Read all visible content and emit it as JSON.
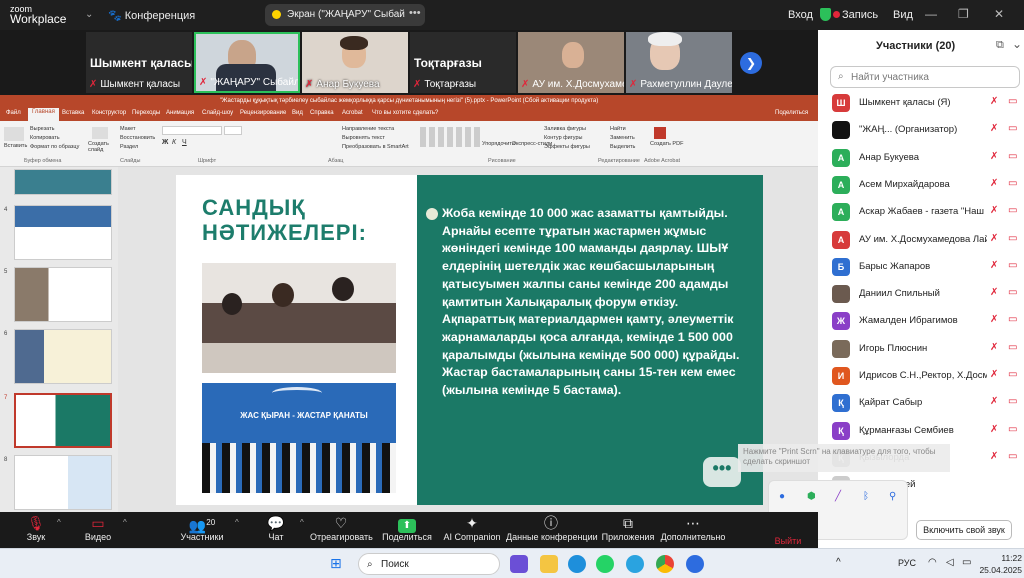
{
  "zoom": {
    "logo_line1": "zoom",
    "logo_line2": "Workplace",
    "conference": "Конференция",
    "screen_share": "Экран (\"ЖАҢАРУ\" Сыбайлас Ж",
    "login": "Вход",
    "record": "Запись",
    "view": "Вид"
  },
  "strip": {
    "tiles": [
      {
        "big": "Шымкент қаласы",
        "name": "Шымкент қаласы"
      },
      {
        "big": "",
        "name": "\"ЖАҢАРУ\" Сыбайлас Же..."
      },
      {
        "big": "",
        "name": "Анар Букуева"
      },
      {
        "big": "Тоқтарғазы",
        "name": "Тоқтарғазы"
      },
      {
        "big": "",
        "name": "АУ им. Х.Досмухамедо..."
      },
      {
        "big": "",
        "name": "Рахметуллин Даулетк..."
      }
    ]
  },
  "ppt": {
    "title": "\"Жастарды құқықтық тәрбиелеу сыбайлас жемқорлыққа қарсы дүниетанымының негізі\" (5).pptx - PowerPoint (Сбой активации продукта)",
    "menu": [
      "Файл",
      "Главная",
      "Вставка",
      "Конструктор",
      "Переходы",
      "Анимация",
      "Слайд-шоу",
      "Рецензирование",
      "Вид",
      "Справка",
      "Acrobat",
      "Что вы хотите сделать?",
      "Поделиться"
    ],
    "ribbon": {
      "clipboard": "Буфер обмена",
      "slides": "Слайды",
      "font": "Шрифт",
      "paragraph": "Абзац",
      "drawing": "Рисование",
      "editing": "Редактирование",
      "adobe": "Adobe Acrobat",
      "cut": "Вырезать",
      "copy": "Копировать",
      "format": "Формат по образцу",
      "paste": "Вставить",
      "new_slide": "Создать слайд",
      "layout": "Макет",
      "reset": "Восстановить",
      "section": "Раздел",
      "text_dir": "Направление текста",
      "align_text": "Выровнять текст",
      "smartart": "Преобразовать в SmartArt",
      "arrange": "Упорядочить",
      "quick_styles": "Экспресс-стили",
      "fill": "Заливка фигуры",
      "outline": "Контур фигуры",
      "effects": "Эффекты фигуры",
      "find": "Найти",
      "replace": "Заменить",
      "select": "Выделить",
      "create_pdf": "Создать PDF"
    },
    "slide_numbers": [
      "4",
      "5",
      "6",
      "7",
      "8"
    ]
  },
  "slide": {
    "title": "САНДЫҚ НӘТИЖЕЛЕРІ:",
    "banner": "ЖАС ҚЫРАН - ЖАСТАР ҚАНАТЫ",
    "body": "Жоба кемінде 10 000 жас азаматты қамтыйды. Арнайы есепте тұратын жастармен жұмыс жөніндегі кемінде 100 маманды даярлау. ШЫҰ елдерінің шетелдік жас көшбасшыларының қатысуымен жалпы саны кемінде 200 адамды қамтитын Халықаралық форум өткізу. Ақпараттық материалдармен қамту, әлеуметтік жарнамаларды қоса алғанда, кемінде 1 500 000 қаралымды (жылына кемінде 500 000) құрайды. Жастар бастамаларының саны 15-тен кем емес (жылына кемінде 5 бастама)."
  },
  "participants": {
    "title": "Участники (20)",
    "search_placeholder": "Найти участника",
    "list": [
      {
        "initial": "Ш",
        "color": "#d73b3b",
        "name": "Шымкент қаласы (Я)"
      },
      {
        "initial": "",
        "color": "#111111",
        "name": "\"ЖАҢ...  (Организатор)"
      },
      {
        "initial": "А",
        "color": "#2cae5a",
        "name": "Анар Букуева"
      },
      {
        "initial": "А",
        "color": "#2cae5a",
        "name": "Асем Мирхайдарова"
      },
      {
        "initial": "А",
        "color": "#2cae5a",
        "name": "Аскар Жабаев - газета \"Наш Ко..."
      },
      {
        "initial": "А",
        "color": "#d73b3b",
        "name": "АУ им. Х.Досмухамедова Лайла ..."
      },
      {
        "initial": "Б",
        "color": "#2f6fd1",
        "name": "Барыс Жапаров"
      },
      {
        "initial": "",
        "color": "#6b5a4f",
        "name": "Даниил Спильный"
      },
      {
        "initial": "Ж",
        "color": "#8a3fc7",
        "name": "Жамалден Ибрагимов"
      },
      {
        "initial": "",
        "color": "#7a6a5a",
        "name": "Игорь Плюснин"
      },
      {
        "initial": "И",
        "color": "#e0571f",
        "name": "Идрисов С.Н.,Ректор, Х.Досмұха..."
      },
      {
        "initial": "Қ",
        "color": "#2f6fd1",
        "name": "Қайрат Сабыр"
      },
      {
        "initial": "Қ",
        "color": "#8a3fc7",
        "name": "Құрманғазы Сембиев"
      },
      {
        "initial": "Қ",
        "color": "#888888",
        "name": "Қызылорда"
      },
      {
        "initial": "",
        "color": "#cccccc",
        "name": "Даулеткерей"
      }
    ],
    "tooltip": "Нажмите \"Print Scrn\" на клавиатуре для того, чтобы сделать скриншот",
    "unmute_label": "Включить свой звук"
  },
  "toolbar": {
    "audio": "Звук",
    "video": "Видео",
    "participants": "Участники",
    "participants_count": "20",
    "chat": "Чат",
    "react": "Отреагировать",
    "share": "Поделиться",
    "ai": "AI Companion",
    "conf_data": "Данные конференции",
    "apps": "Приложения",
    "more": "Дополнительно",
    "leave": "Выйти"
  },
  "taskbar": {
    "search": "Поиск",
    "lang": "РУС",
    "time": "11:22",
    "date": "25.04.2025"
  }
}
